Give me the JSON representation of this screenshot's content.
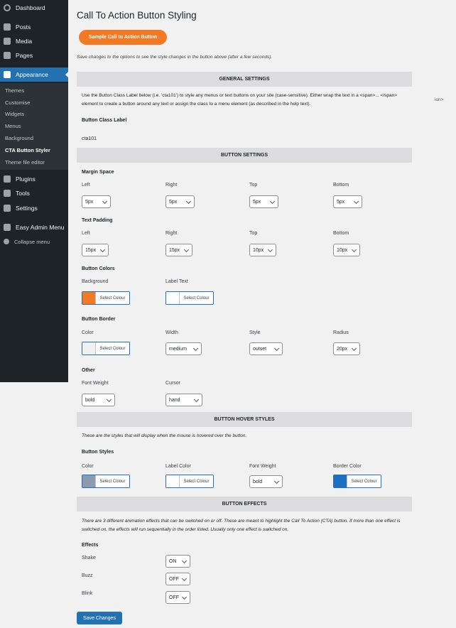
{
  "sidebar": {
    "items": [
      {
        "label": "Dashboard",
        "icon": "dashboard-icon"
      },
      {
        "label": "Posts",
        "icon": "pin-icon"
      },
      {
        "label": "Media",
        "icon": "media-icon"
      },
      {
        "label": "Pages",
        "icon": "page-icon"
      },
      {
        "label": "Appearance",
        "icon": "brush-icon"
      },
      {
        "label": "Plugins",
        "icon": "plug-icon"
      },
      {
        "label": "Tools",
        "icon": "wrench-icon"
      },
      {
        "label": "Settings",
        "icon": "settings-icon"
      },
      {
        "label": "Easy Admin Menu",
        "icon": "bolt-icon"
      },
      {
        "label": "Collapse menu",
        "icon": "collapse-icon"
      }
    ],
    "submenu": [
      "Themes",
      "Customise",
      "Widgets",
      "Menus",
      "Background",
      "CTA Button Styler",
      "Theme file editor"
    ]
  },
  "page": {
    "title": "Call To Action Button Styling",
    "sample_button": "Sample Call to Action Button",
    "save_note": "Save changes to the options to see the style changes in the button above (after a few seconds).",
    "stray_text": "ion>"
  },
  "general": {
    "heading": "GENERAL SETTINGS",
    "desc": "Use the Button Class Label below (i.e. 'cta101') to style any menus or text buttons on your site (case-sensitive). Either wrap the text in a <span>... </span> element to create a button around any text or assign the class to a menu element (as described in the help text).",
    "class_label": "Button Class Label",
    "class_value": "cta101"
  },
  "button_settings": {
    "heading": "BUTTON SETTINGS",
    "margin": {
      "title": "Margin Space",
      "labels": [
        "Left",
        "Right",
        "Top",
        "Bottom"
      ],
      "values": [
        "5px",
        "5px",
        "5px",
        "5px"
      ]
    },
    "padding": {
      "title": "Text Padding",
      "labels": [
        "Left",
        "Right",
        "Top",
        "Bottom"
      ],
      "values": [
        "15px",
        "15px",
        "10px",
        "10px"
      ]
    },
    "colors": {
      "title": "Button Colors",
      "background_label": "Background",
      "label_text_label": "Label Text",
      "background_color": "#f27a25",
      "label_text_color": "#ffffff"
    },
    "border": {
      "title": "Button Border",
      "labels": [
        "Color",
        "Width",
        "Style",
        "Radius"
      ],
      "color": "#f0f0f1",
      "width": "medium",
      "style": "outset",
      "radius": "20px"
    },
    "other": {
      "title": "Other",
      "labels": [
        "Font Weight",
        "Cursor"
      ],
      "font_weight": "bold",
      "cursor": "hand"
    }
  },
  "hover": {
    "heading": "BUTTON HOVER STYLES",
    "desc": "These are the styles that will display when the mouse is hovered over the button.",
    "title": "Button Styles",
    "labels": [
      "Color",
      "Label Color",
      "Font Weight",
      "Border Color"
    ],
    "color": "#8a9bb1",
    "label_color": "#ffffff",
    "font_weight": "bold",
    "border_color": "#1e6fbf"
  },
  "effects": {
    "heading": "BUTTON EFFECTS",
    "desc": "There are 3 different animation effects that can be switched on or off. These are meant to highlight the Call To Action (CTA) button. If more than one effect is switched on, the effects will run sequentially in the order listed. Usually only one effect is switched on.",
    "title": "Effects",
    "items": [
      {
        "label": "Shake",
        "value": "ON"
      },
      {
        "label": "Buzz",
        "value": "OFF"
      },
      {
        "label": "Blink",
        "value": "OFF"
      }
    ]
  },
  "select_colour": "Select Colour",
  "save_button": "Save Changes",
  "accent": "#2271b1"
}
